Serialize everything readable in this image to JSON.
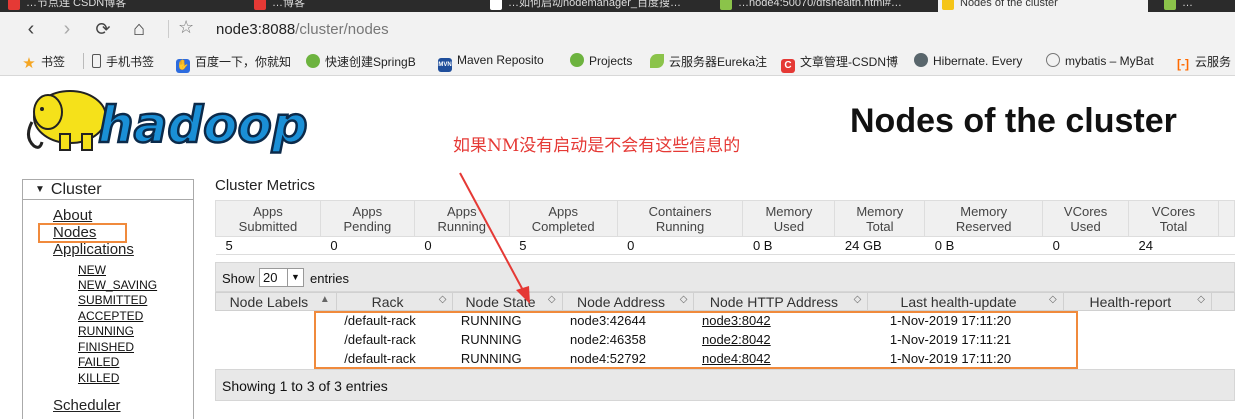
{
  "browser": {
    "tabs": [
      {
        "label": "…节点连 CSDN博客",
        "color": "#e53935"
      },
      {
        "label": "…博客",
        "color": "#e53935"
      },
      {
        "label": "…如何启动nodemanager_百度搜…",
        "color": "#ffffff"
      },
      {
        "label": "…node4:50070/dfshealth.html#…",
        "color": "#8bc34a"
      },
      {
        "label": "Nodes of the cluster",
        "color": "#f5c518"
      },
      {
        "label": "…",
        "color": "#8bc34a"
      }
    ],
    "url_host": "node3:8088",
    "url_path": "/cluster/nodes",
    "bookmarks": [
      {
        "label": "书签",
        "icon": "star-icon",
        "color": "#f5a623"
      },
      {
        "label": "手机书签",
        "icon": "phone-icon",
        "color": "#555555"
      },
      {
        "label": "百度一下，你就知",
        "icon": "baidu-icon",
        "color": "#2d6cdf"
      },
      {
        "label": "快速创建SpringB",
        "icon": "spring-icon",
        "color": "#6db33f"
      },
      {
        "label": "Maven Reposito",
        "icon": "maven-icon",
        "color": "#1f4e9b"
      },
      {
        "label": "Projects",
        "icon": "spring-icon",
        "color": "#6db33f"
      },
      {
        "label": "云服务器Eureka注",
        "icon": "leaf-icon",
        "color": "#8bc34a"
      },
      {
        "label": "文章管理-CSDN博",
        "icon": "csdn-icon",
        "color": "#e53935"
      },
      {
        "label": "Hibernate. Every",
        "icon": "hibernate-icon",
        "color": "#59666c"
      },
      {
        "label": "mybatis – MyBat",
        "icon": "globe-icon",
        "color": "#777777"
      },
      {
        "label": "云服务",
        "icon": "aliyun-icon",
        "color": "#ff6a00"
      }
    ]
  },
  "header": {
    "logo_text": "hadoop",
    "title": "Nodes of the cluster",
    "annotation": "如果NM没有启动是不会有这些信息的"
  },
  "sidebar": {
    "section": "Cluster",
    "links": [
      "About",
      "Nodes",
      "Applications"
    ],
    "app_states": [
      "NEW",
      "NEW_SAVING",
      "SUBMITTED",
      "ACCEPTED",
      "RUNNING",
      "FINISHED",
      "FAILED",
      "KILLED"
    ],
    "scheduler": "Scheduler"
  },
  "metrics": {
    "title": "Cluster Metrics",
    "headers": [
      [
        "Apps",
        "Submitted"
      ],
      [
        "Apps",
        "Pending"
      ],
      [
        "Apps",
        "Running"
      ],
      [
        "Apps",
        "Completed"
      ],
      [
        "Containers",
        "Running"
      ],
      [
        "Memory",
        "Used"
      ],
      [
        "Memory",
        "Total"
      ],
      [
        "Memory",
        "Reserved"
      ],
      [
        "VCores",
        "Used"
      ],
      [
        "VCores",
        "Total"
      ]
    ],
    "values": [
      "5",
      "0",
      "0",
      "5",
      "0",
      "0 B",
      "24 GB",
      "0 B",
      "0",
      "24"
    ]
  },
  "datatable": {
    "show_label": "Show",
    "page_size": "20",
    "entries_label": "entries",
    "columns": [
      "Node Labels",
      "Rack",
      "Node State",
      "Node Address",
      "Node HTTP Address",
      "Last health-update",
      "Health-report"
    ],
    "rows": [
      {
        "labels": "",
        "rack": "/default-rack",
        "state": "RUNNING",
        "address": "node3:42644",
        "http": "node3:8042",
        "health_update": "1-Nov-2019 17:11:20",
        "report": ""
      },
      {
        "labels": "",
        "rack": "/default-rack",
        "state": "RUNNING",
        "address": "node2:46358",
        "http": "node2:8042",
        "health_update": "1-Nov-2019 17:11:21",
        "report": ""
      },
      {
        "labels": "",
        "rack": "/default-rack",
        "state": "RUNNING",
        "address": "node4:52792",
        "http": "node4:8042",
        "health_update": "1-Nov-2019 17:11:20",
        "report": ""
      }
    ],
    "footer": "Showing 1 to 3 of 3 entries"
  },
  "colors": {
    "highlight": "#f08a3c",
    "annotation": "#e53935",
    "logo_fill": "#1a8fd6",
    "elephant": "#f5e11a"
  }
}
